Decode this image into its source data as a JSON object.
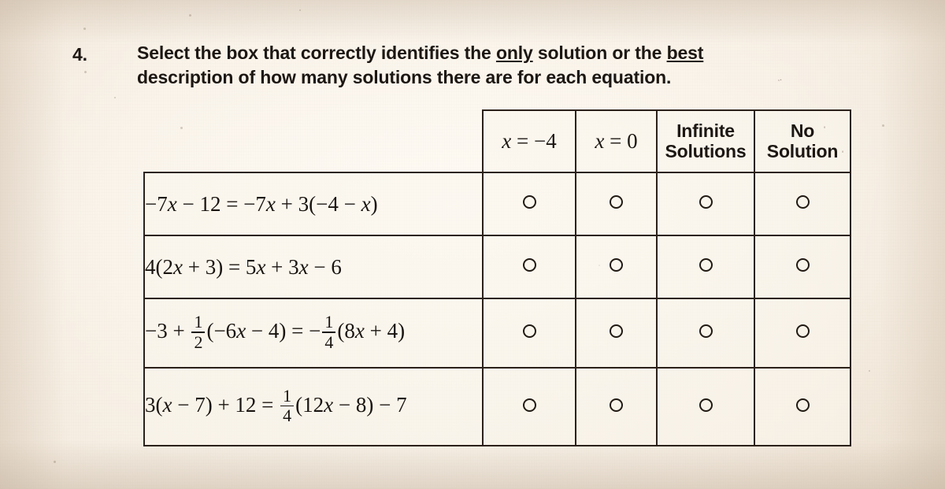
{
  "question": {
    "number": "4.",
    "line1_a": "Select the box that correctly identifies the ",
    "line1_emph": "only",
    "line1_b": " solution or the ",
    "line1_emph2": "best",
    "line2": "description of how many solutions there are for each equation."
  },
  "table": {
    "headers": [
      {
        "type": "math",
        "lhs": "x",
        "rel": " = ",
        "rhs": "−4"
      },
      {
        "type": "math",
        "lhs": "x",
        "rel": " = ",
        "rhs": "0"
      },
      {
        "type": "text",
        "line1": "Infinite",
        "line2": "Solutions"
      },
      {
        "type": "text",
        "line1": "No",
        "line2": "Solution"
      }
    ],
    "rows": [
      {
        "equation_plain": "−7x − 12 = −7x + 3(−4 − x)",
        "parts": [
          {
            "t": "txt",
            "v": "−7"
          },
          {
            "t": "var",
            "v": "x"
          },
          {
            "t": "txt",
            "v": " − 12 = −7"
          },
          {
            "t": "var",
            "v": "x"
          },
          {
            "t": "txt",
            "v": " + 3(−4 − "
          },
          {
            "t": "var",
            "v": "x"
          },
          {
            "t": "txt",
            "v": ")"
          }
        ],
        "options": [
          "x = -4",
          "x = 0",
          "Infinite Solutions",
          "No Solution"
        ],
        "selected": null
      },
      {
        "equation_plain": "4(2x + 3) = 5x + 3x − 6",
        "parts": [
          {
            "t": "txt",
            "v": "4(2"
          },
          {
            "t": "var",
            "v": "x"
          },
          {
            "t": "txt",
            "v": " + 3) = 5"
          },
          {
            "t": "var",
            "v": "x"
          },
          {
            "t": "txt",
            "v": " + 3"
          },
          {
            "t": "var",
            "v": "x"
          },
          {
            "t": "txt",
            "v": " − 6"
          }
        ],
        "options": [
          "x = -4",
          "x = 0",
          "Infinite Solutions",
          "No Solution"
        ],
        "selected": null
      },
      {
        "equation_plain": "−3 + 1/2(−6x − 4) = −1/4(8x + 4)",
        "parts": [
          {
            "t": "txt",
            "v": "−3 + "
          },
          {
            "t": "frac",
            "num": "1",
            "den": "2"
          },
          {
            "t": "txt",
            "v": "(−6"
          },
          {
            "t": "var",
            "v": "x"
          },
          {
            "t": "txt",
            "v": " − 4) = −"
          },
          {
            "t": "frac",
            "num": "1",
            "den": "4"
          },
          {
            "t": "txt",
            "v": "(8"
          },
          {
            "t": "var",
            "v": "x"
          },
          {
            "t": "txt",
            "v": " + 4)"
          }
        ],
        "options": [
          "x = -4",
          "x = 0",
          "Infinite Solutions",
          "No Solution"
        ],
        "selected": null
      },
      {
        "equation_plain": "3(x − 7) + 12 = 1/4(12x − 8) − 7",
        "parts": [
          {
            "t": "txt",
            "v": "3("
          },
          {
            "t": "var",
            "v": "x"
          },
          {
            "t": "txt",
            "v": " − 7) + 12 = "
          },
          {
            "t": "frac",
            "num": "1",
            "den": "4"
          },
          {
            "t": "txt",
            "v": "(12"
          },
          {
            "t": "var",
            "v": "x"
          },
          {
            "t": "txt",
            "v": " − 8) − 7"
          }
        ],
        "options": [
          "x = -4",
          "x = 0",
          "Infinite Solutions",
          "No Solution"
        ],
        "selected": null
      }
    ]
  },
  "colors": {
    "paper": "#f5ece0",
    "ink": "#1d1713",
    "rule": "#2b211a"
  }
}
